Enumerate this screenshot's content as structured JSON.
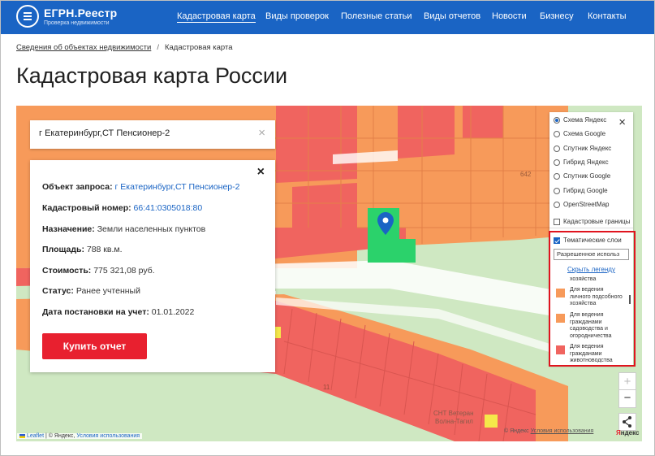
{
  "logo": {
    "title": "ЕГРН.Реестр",
    "subtitle": "Проверка недвижимости"
  },
  "nav": {
    "items": [
      "Кадастровая карта",
      "Виды проверок",
      "Полезные статьи",
      "Виды отчетов",
      "Новости",
      "Бизнесу",
      "Контакты"
    ],
    "active": "Кадастровая карта"
  },
  "breadcrumb": {
    "items": [
      "Сведения об объектах недвижимости",
      "Кадастровая карта"
    ],
    "separator": "/"
  },
  "page": {
    "title": "Кадастровая карта России"
  },
  "search": {
    "value": "г Екатеринбург,СТ Пенсионер-2",
    "clear_icon": "×"
  },
  "info": {
    "close_icon": "×",
    "rows": [
      {
        "label": "Объект запроса:",
        "value": "г Екатеринбург,СТ Пенсионер-2",
        "link": true
      },
      {
        "label": "Кадастровый номер:",
        "value": "66:41:0305018:80",
        "link": true
      },
      {
        "label": "Назначение:",
        "value": "Земли населенных пунктов",
        "link": false
      },
      {
        "label": "Площадь:",
        "value": "788 кв.м.",
        "link": false
      },
      {
        "label": "Стоимость:",
        "value": "775 321,08 руб.",
        "link": false
      },
      {
        "label": "Статус:",
        "value": "Ранее учтенный",
        "link": false
      },
      {
        "label": "Дата постановки на учет:",
        "value": "01.01.2022",
        "link": false
      }
    ],
    "buy_label": "Купить отчет"
  },
  "layers": {
    "close_icon": "×",
    "base_options": [
      "Схема Яндекс",
      "Схема Google",
      "Спутник Яндекс",
      "Гибрид Яндекс",
      "Спутник Google",
      "Гибрид Google",
      "OpenStreetMap"
    ],
    "base_selected": "Схема Яндекс",
    "cadastral_borders": {
      "label": "Кадастровые границы",
      "checked": false
    },
    "thematic": {
      "label": "Тематические слои",
      "checked": true
    },
    "select_value": "Разрешенное использ",
    "legend_toggle": "Скрыть легенду",
    "legend_cut_text": "хозяйства",
    "legend": [
      {
        "label": "Для ведения личного подсобного хозяйства",
        "color": "#f79a5a"
      },
      {
        "label": "Для ведения гражданами садоводства и огородничества",
        "color": "#f79a5a"
      },
      {
        "label": "Для ведения гражданами животноводства",
        "color": "#f0645f"
      }
    ]
  },
  "map": {
    "labels": [
      "642",
      "11",
      "СНТ Ветеран",
      "Волна-Тагил"
    ],
    "colors": {
      "orange": "#f79a5a",
      "red": "#f0645f",
      "green": "#2bd26b",
      "bg": "#cfe8c2",
      "road": "#ffffff",
      "yellow": "#f5e84a",
      "marker": "#1a64c4"
    },
    "zoom_in": "+",
    "zoom_out": "−",
    "share_icon": "share-icon"
  },
  "attribution": {
    "left_leaflet": "Leaflet",
    "left_middle": "| © Яндекс,",
    "left_terms": "Условия использования",
    "right": "© Яндекс",
    "right_terms": "Условия использования",
    "yandex_mark": "Я",
    "yandex_rest": "ндекс"
  }
}
